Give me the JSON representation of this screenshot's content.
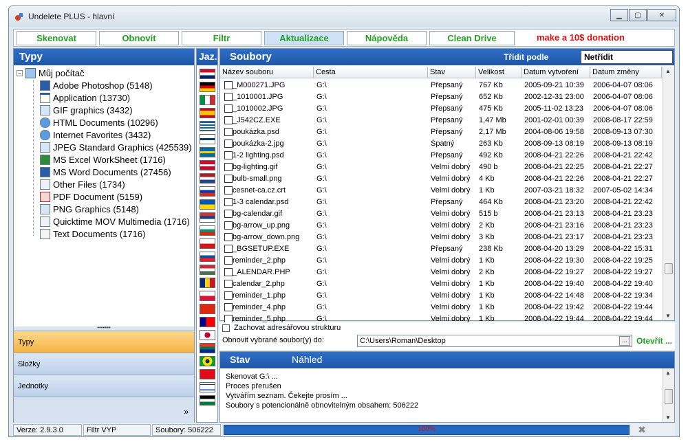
{
  "window": {
    "title": "Undelete PLUS - hlavní"
  },
  "toolbar": {
    "buttons": [
      "Skenovat",
      "Obnovit",
      "Filtr",
      "Aktualizace",
      "Nápověda",
      "Clean Drive"
    ],
    "donation": "make a 10$ donation"
  },
  "left": {
    "header": "Typy",
    "root": "Můj počítač",
    "items": [
      "Adobe Photoshop (5148)",
      "Application (13730)",
      "GIF graphics (3432)",
      "HTML Documents (10296)",
      "Internet Favorites (3432)",
      "JPEG Standard Graphics (425539)",
      "MS Excel WorkSheet (1716)",
      "MS Word Documents (27456)",
      "Other Files (1734)",
      "PDF Document (5159)",
      "PNG Graphics (5148)",
      "Quicktime MOV Multimedia (1716)",
      "Text Documents (1716)"
    ],
    "nav": [
      "Typy",
      "Složky",
      "Jednotky"
    ],
    "more": "»"
  },
  "lang": {
    "header": "Jaz."
  },
  "files": {
    "header": "Soubory",
    "sort_label": "Třídit podle",
    "sort_value": "Netřídit",
    "columns": [
      "Název souboru",
      "Cesta",
      "Stav",
      "Velikost",
      "Datum vytvoření",
      "Datum změny"
    ],
    "rows": [
      [
        "_M000271.JPG",
        "G:\\",
        "Přepsaný",
        "767 Kb",
        "2005-09-21 10:39",
        "2006-04-07 08:06"
      ],
      [
        "_1010001.JPG",
        "G:\\",
        "Přepsaný",
        "652 Kb",
        "2002-12-31 23:00",
        "2006-04-07 08:06"
      ],
      [
        "_1010002.JPG",
        "G:\\",
        "Přepsaný",
        "475 Kb",
        "2005-11-02 13:23",
        "2006-04-07 08:06"
      ],
      [
        "_J542CZ.EXE",
        "G:\\",
        "Přepsaný",
        "1,47 Mb",
        "2001-02-01 00:39",
        "2008-08-17 22:59"
      ],
      [
        "poukázka.psd",
        "G:\\",
        "Přepsaný",
        "2,17 Mb",
        "2004-08-06 19:58",
        "2008-09-13 07:30"
      ],
      [
        "poukázka-2.jpg",
        "G:\\",
        "Špatný",
        "263 Kb",
        "2008-09-13 08:19",
        "2008-09-13 08:19"
      ],
      [
        "1-2 lighting.psd",
        "G:\\",
        "Přepsaný",
        "492 Kb",
        "2008-04-21 22:26",
        "2008-04-21 22:42"
      ],
      [
        "bg-lighting.gif",
        "G:\\",
        "Velmi dobrý",
        "490 b",
        "2008-04-21 22:25",
        "2008-04-21 22:27"
      ],
      [
        "bulb-small.png",
        "G:\\",
        "Velmi dobrý",
        "4 Kb",
        "2008-04-21 22:26",
        "2008-04-21 22:27"
      ],
      [
        "cesnet-ca.cz.crt",
        "G:\\",
        "Velmi dobrý",
        "1 Kb",
        "2007-03-21 18:32",
        "2007-05-02 14:34"
      ],
      [
        "1-3 calendar.psd",
        "G:\\",
        "Přepsaný",
        "464 Kb",
        "2008-04-21 23:20",
        "2008-04-21 22:42"
      ],
      [
        "bg-calendar.gif",
        "G:\\",
        "Velmi dobrý",
        "515 b",
        "2008-04-21 23:13",
        "2008-04-21 23:23"
      ],
      [
        "bg-arrow_up.png",
        "G:\\",
        "Velmi dobrý",
        "2 Kb",
        "2008-04-21 23:16",
        "2008-04-21 23:23"
      ],
      [
        "bg-arrow_down.png",
        "G:\\",
        "Velmi dobrý",
        "3 Kb",
        "2008-04-21 23:17",
        "2008-04-21 23:23"
      ],
      [
        "_BGSETUP.EXE",
        "G:\\",
        "Přepsaný",
        "238 Kb",
        "2008-04-20 13:29",
        "2008-04-22 15:31"
      ],
      [
        "reminder_2.php",
        "G:\\",
        "Velmi dobrý",
        "1 Kb",
        "2008-04-22 19:30",
        "2008-04-22 19:25"
      ],
      [
        "_ALENDAR.PHP",
        "G:\\",
        "Velmi dobrý",
        "2 Kb",
        "2008-04-22 19:27",
        "2008-04-22 19:27"
      ],
      [
        "calendar_2.php",
        "G:\\",
        "Velmi dobrý",
        "1 Kb",
        "2008-04-22 19:40",
        "2008-04-22 19:40"
      ],
      [
        "reminder_1.php",
        "G:\\",
        "Velmi dobrý",
        "1 Kb",
        "2008-04-22 14:48",
        "2008-04-22 19:34"
      ],
      [
        "reminder_4.php",
        "G:\\",
        "Velmi dobrý",
        "1 Kb",
        "2008-04-22 19:42",
        "2008-04-22 19:44"
      ],
      [
        "reminder_5.php",
        "G:\\",
        "Velmi dobrý",
        "1 Kb",
        "2008-04-22 19:44",
        "2008-04-22 19:44"
      ]
    ]
  },
  "restore": {
    "keep_structure": "Zachovat adresářovou strukturu",
    "label": "Obnovit vybrané soubor(y) do:",
    "path": "C:\\Users\\Roman\\Desktop",
    "browse": "...",
    "open": "Otevřít ..."
  },
  "log": {
    "tab_status": "Stav",
    "tab_preview": "Náhled",
    "lines": [
      "Skenovat G:\\ ...",
      "Proces přerušen",
      "Vytvářím seznam. Čekejte prosím ...",
      "Soubory s potencionálně obnovitelným obsahem: 506222"
    ]
  },
  "status": {
    "version": "Verze: 2.9.3.0",
    "filter": "Filtr VYP",
    "files": "Soubory: 506222",
    "progress": "100%"
  },
  "colors": {
    "accent": "#1e56a8",
    "green": "#23a023",
    "red": "#e01010",
    "nav_selected": "#f4b343"
  }
}
